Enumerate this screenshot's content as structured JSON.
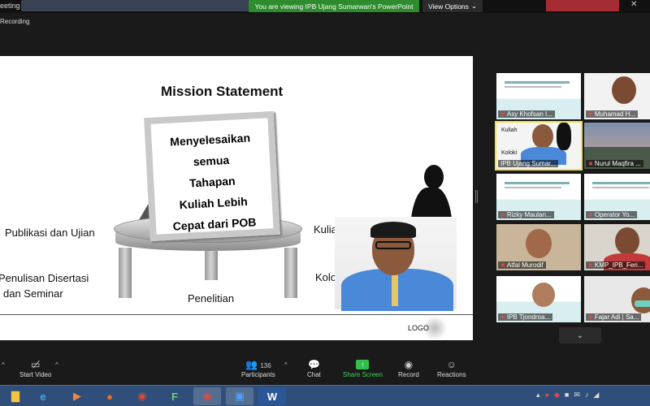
{
  "top": {
    "window_title": "eeting",
    "view_banner": "You are viewing IPB Ujang Sumarwan's PowerPoint",
    "view_options": "View Options",
    "view_options_caret": "⌄",
    "recording": "Recording",
    "close_glyph": "✕"
  },
  "slide": {
    "title": "Mission Statement",
    "board_lines": [
      "Menyelesaikan",
      "semua",
      "Tahapan",
      "Kuliah Lebih",
      "Cepat dari POB"
    ],
    "labels": {
      "publikasi": "Publikasi dan Ujian",
      "penulisan_1": "Penulisan Disertasi",
      "penulisan_2": "dan Seminar",
      "penelitian": "Penelitian",
      "kuliah": "Kuliah",
      "kolokium": "Kolokium"
    },
    "logo": "LOGO"
  },
  "participants": [
    {
      "name": "Asy Khofsan I...",
      "muted": true
    },
    {
      "name": "Muhamad H...",
      "muted": true
    },
    {
      "name": "IPB Ujang Sumar...",
      "muted": false,
      "overlay_1": "Kuliah",
      "overlay_2": "Koloki"
    },
    {
      "name": "Nurul Maqfira ...",
      "muted": true
    },
    {
      "name": "Rizky Maulan...",
      "muted": true
    },
    {
      "name": "Operator Yo...",
      "muted": true
    },
    {
      "name": "Atfal Murodif",
      "muted": true
    },
    {
      "name": "KMP_IPB_Feri...",
      "muted": true
    },
    {
      "name": "IPB Tjondroa...",
      "muted": true
    },
    {
      "name": "Fajar Adi | Sa...",
      "muted": true
    }
  ],
  "scroll_down_glyph": "⌄",
  "toolbar": {
    "start_video": "Start Video",
    "participants": "Participants",
    "participants_count": "136",
    "chat": "Chat",
    "share_screen": "Share Screen",
    "record": "Record",
    "reactions": "Reactions",
    "caret": "^",
    "share_glyph": "↑"
  },
  "colors": {
    "banner_green": "#2d8c2d",
    "share_green": "#3bd35a",
    "active_speaker": "#f2e14c",
    "taskbar": "#2f4f7a"
  },
  "taskbar_apps": [
    {
      "icon": "file-explorer-icon",
      "glyph": "▇"
    },
    {
      "icon": "internet-explorer-icon",
      "glyph": "e"
    },
    {
      "icon": "media-player-icon",
      "glyph": "▶"
    },
    {
      "icon": "firefox-icon",
      "glyph": "●"
    },
    {
      "icon": "chrome-icon",
      "glyph": "◉"
    },
    {
      "icon": "f-app-icon",
      "glyph": "F"
    },
    {
      "icon": "chrome-icon-2",
      "glyph": "◉"
    },
    {
      "icon": "zoom-icon",
      "glyph": "▣"
    },
    {
      "icon": "word-icon",
      "glyph": "W"
    }
  ],
  "tray": {
    "glyphs": [
      "▴",
      "●",
      "◆",
      "■",
      "✉",
      "♪",
      "◢"
    ]
  }
}
